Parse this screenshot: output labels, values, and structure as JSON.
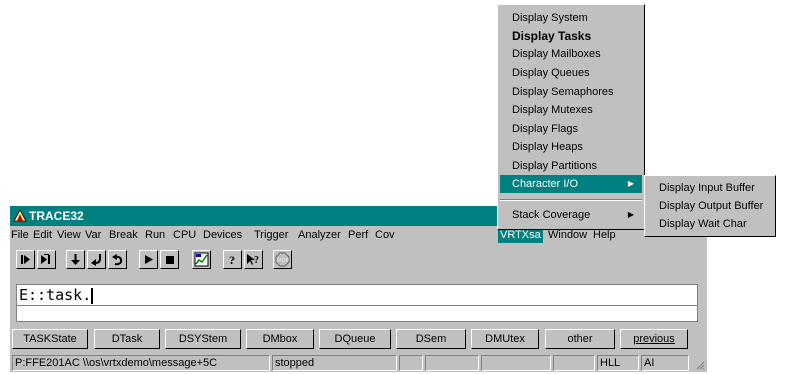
{
  "window": {
    "title": "TRACE32"
  },
  "menubar": {
    "items": [
      "File",
      "Edit",
      "View",
      "Var",
      "Break",
      "Run",
      "CPU",
      "Devices",
      "Trigger",
      "Analyzer",
      "Perf",
      "Cov",
      "VRTXsa",
      "Window",
      "Help"
    ],
    "active": "VRTXsa"
  },
  "toolbar": {
    "icons": [
      "step-icon",
      "step-over-icon",
      "step-down-icon",
      "step-return-icon",
      "undo-icon",
      "go-icon",
      "stop-icon",
      "memory-map-icon",
      "help-icon",
      "context-help-icon",
      "stop-sign-icon"
    ]
  },
  "command": {
    "text": "E::task."
  },
  "softkeys": [
    "TASKState",
    "DTask",
    "DSYStem",
    "DMbox",
    "DQueue",
    "DSem",
    "DMUtex",
    "other",
    "previous"
  ],
  "status": {
    "address": "P:FFE201AC  \\\\os\\vrtxdemo\\message+5C",
    "state": "stopped",
    "mode": "HLL",
    "extra": "AI"
  },
  "vrtx_menu": {
    "items": [
      "Display System",
      "Display Tasks",
      "Display Mailboxes",
      "Display Queues",
      "Display Semaphores",
      "Display Mutexes",
      "Display Flags",
      "Display Heaps",
      "Display Partitions",
      "Character I/O",
      "Stack Coverage"
    ],
    "bold_item": "Display Tasks",
    "highlighted": "Character I/O"
  },
  "chario_menu": {
    "items": [
      "Display Input Buffer",
      "Display Output Buffer",
      "Display Wait Char"
    ]
  },
  "colors": {
    "titlebar": "#008080",
    "face": "#c0c0c0",
    "highlight": "#008080"
  }
}
